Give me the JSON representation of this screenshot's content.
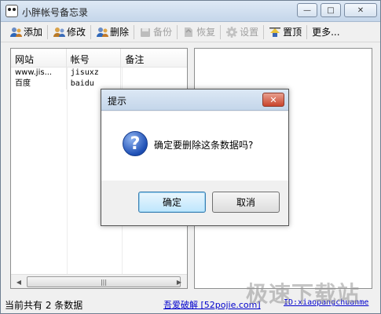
{
  "window": {
    "title": "小胖帐号备忘录",
    "minimize_glyph": "—",
    "maximize_glyph": "□",
    "close_glyph": "✕"
  },
  "toolbar": {
    "items": [
      {
        "label": "添加",
        "icon": "add-user-icon",
        "enabled": true
      },
      {
        "label": "修改",
        "icon": "edit-user-icon",
        "enabled": true
      },
      {
        "label": "删除",
        "icon": "delete-user-icon",
        "enabled": true
      },
      {
        "label": "备份",
        "icon": "backup-icon",
        "enabled": false
      },
      {
        "label": "恢复",
        "icon": "restore-icon",
        "enabled": false
      },
      {
        "label": "设置",
        "icon": "gear-icon",
        "enabled": false
      },
      {
        "label": "置顶",
        "icon": "pin-icon",
        "enabled": true
      },
      {
        "label": "更多...",
        "icon": "",
        "enabled": true
      }
    ]
  },
  "list": {
    "columns": [
      "网站",
      "帐号",
      "备注"
    ],
    "rows": [
      {
        "site": "www.jis...",
        "account": "jisuxz",
        "note": ""
      },
      {
        "site": "百度",
        "account": "baidu",
        "note": ""
      }
    ],
    "scroll_grip": "|||"
  },
  "status": {
    "count_text": "当前共有 2 条数据",
    "link1": "吾爱破解 [52pojie.com]",
    "link2": "ID:xiaopangchuanme"
  },
  "watermark": "极速下载站",
  "dialog": {
    "title": "提示",
    "message": "确定要删除这条数据吗?",
    "ok_label": "确定",
    "cancel_label": "取消",
    "icon": "question-icon",
    "close_glyph": "✕"
  }
}
